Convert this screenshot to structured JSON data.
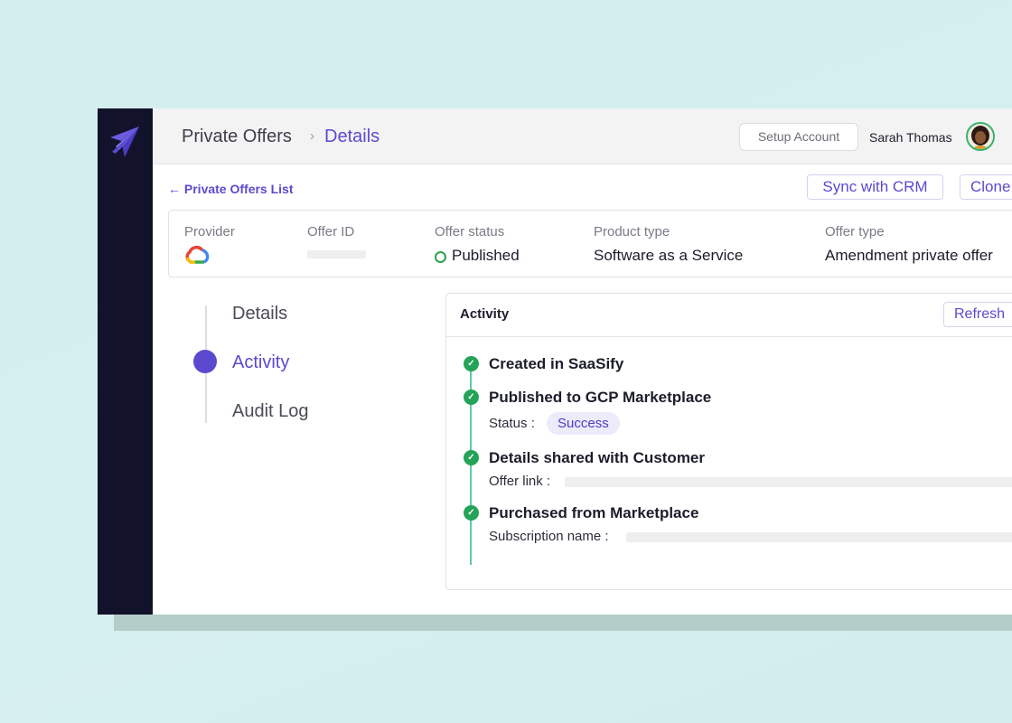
{
  "header": {
    "breadcrumb_root": "Private Offers",
    "breadcrumb_separator": "›",
    "breadcrumb_current": "Details",
    "setup_account_label": "Setup Account",
    "user_name": "Sarah Thomas"
  },
  "actions": {
    "back_link": "← Private Offers List",
    "sync_label": "Sync with CRM",
    "clone_label": "Clone"
  },
  "summary": {
    "provider_label": "Provider",
    "offer_id_label": "Offer ID",
    "offer_status_label": "Offer status",
    "offer_status_value": "Published",
    "product_type_label": "Product type",
    "product_type_value": "Software as a Service",
    "offer_type_label": "Offer type",
    "offer_type_value": "Amendment private offer"
  },
  "steps": [
    {
      "label": "Details",
      "active": false
    },
    {
      "label": "Activity",
      "active": true
    },
    {
      "label": "Audit Log",
      "active": false
    }
  ],
  "activity": {
    "title": "Activity",
    "refresh_label": "Refresh",
    "events": [
      {
        "title": "Created in SaaSify"
      },
      {
        "title": "Published to GCP Marketplace",
        "detail_label": "Status :",
        "badge": "Success"
      },
      {
        "title": "Details shared with Customer",
        "detail_label": "Offer link :"
      },
      {
        "title": "Purchased from Marketplace",
        "detail_label": "Subscription name :"
      }
    ]
  },
  "colors": {
    "accent": "#5b4ad0",
    "sidebar": "#13122b",
    "success": "#23a357",
    "background": "#d3eeee"
  },
  "icons": {
    "logo": "paper-plane-icon",
    "provider": "google-cloud-icon",
    "status": "status-ring-icon",
    "check": "check-icon"
  }
}
